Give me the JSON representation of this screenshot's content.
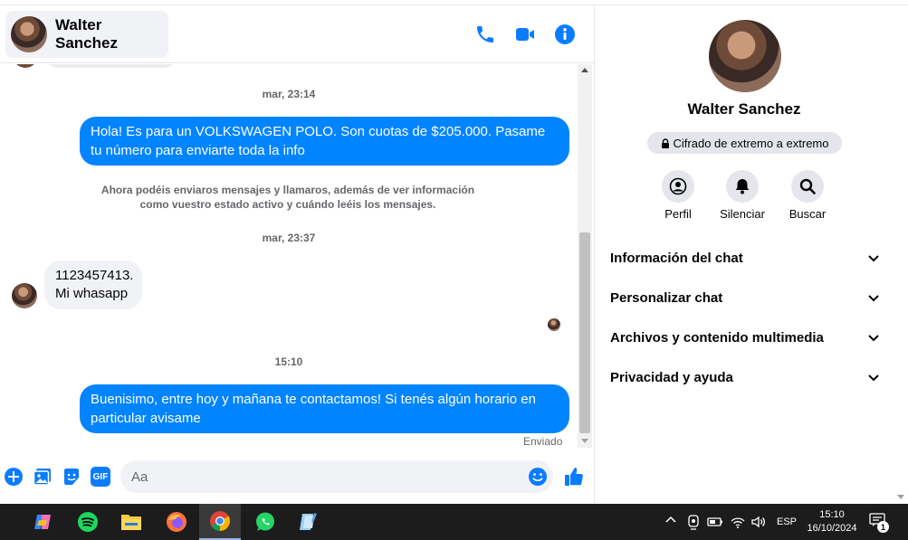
{
  "header": {
    "contact_name": "Walter Sanchez",
    "icons": [
      "phone-icon",
      "video-icon",
      "info-icon"
    ]
  },
  "messages": {
    "timestamp_1": "mar, 23:14",
    "outgoing_1": "Hola! Es para un VOLKSWAGEN POLO. Son cuotas de $205.000. Pasame tu número para enviarte toda la info",
    "notice": "Ahora podéis enviaros mensajes y llamaros, además de ver información como vuestro estado activo y cuándo leéis los mensajes.",
    "timestamp_2": "mar, 23:37",
    "incoming_1_line1": "1123457413.",
    "incoming_1_line2": "Mi whasapp",
    "timestamp_3": "15:10",
    "outgoing_2": "Buenisimo, entre hoy y mañana te contactamos! Si tenés algún horario en particular avisame",
    "status": "Enviado"
  },
  "composer": {
    "placeholder": "Aa",
    "gif_label": "GIF"
  },
  "panel": {
    "name": "Walter Sanchez",
    "encryption": "Cifrado de extremo a extremo",
    "actions": [
      {
        "label": "Perfil",
        "icon": "profile-icon"
      },
      {
        "label": "Silenciar",
        "icon": "bell-icon"
      },
      {
        "label": "Buscar",
        "icon": "search-icon"
      }
    ],
    "sections": [
      "Información del chat",
      "Personalizar chat",
      "Archivos y contenido multimedia",
      "Privacidad y ayuda"
    ]
  },
  "taskbar": {
    "apps": [
      "copilot-icon",
      "spotify-icon",
      "file-explorer-icon",
      "firefox-icon",
      "chrome-icon",
      "whatsapp-icon",
      "notepad-icon"
    ],
    "language": "ESP",
    "time": "15:10",
    "date": "16/10/2024",
    "notification_count": "1"
  },
  "colors": {
    "accent": "#0084ff",
    "messenger_blue": "#0a7cff",
    "bubble_in": "#f0f2f5",
    "taskbar": "#1c1c1c"
  }
}
